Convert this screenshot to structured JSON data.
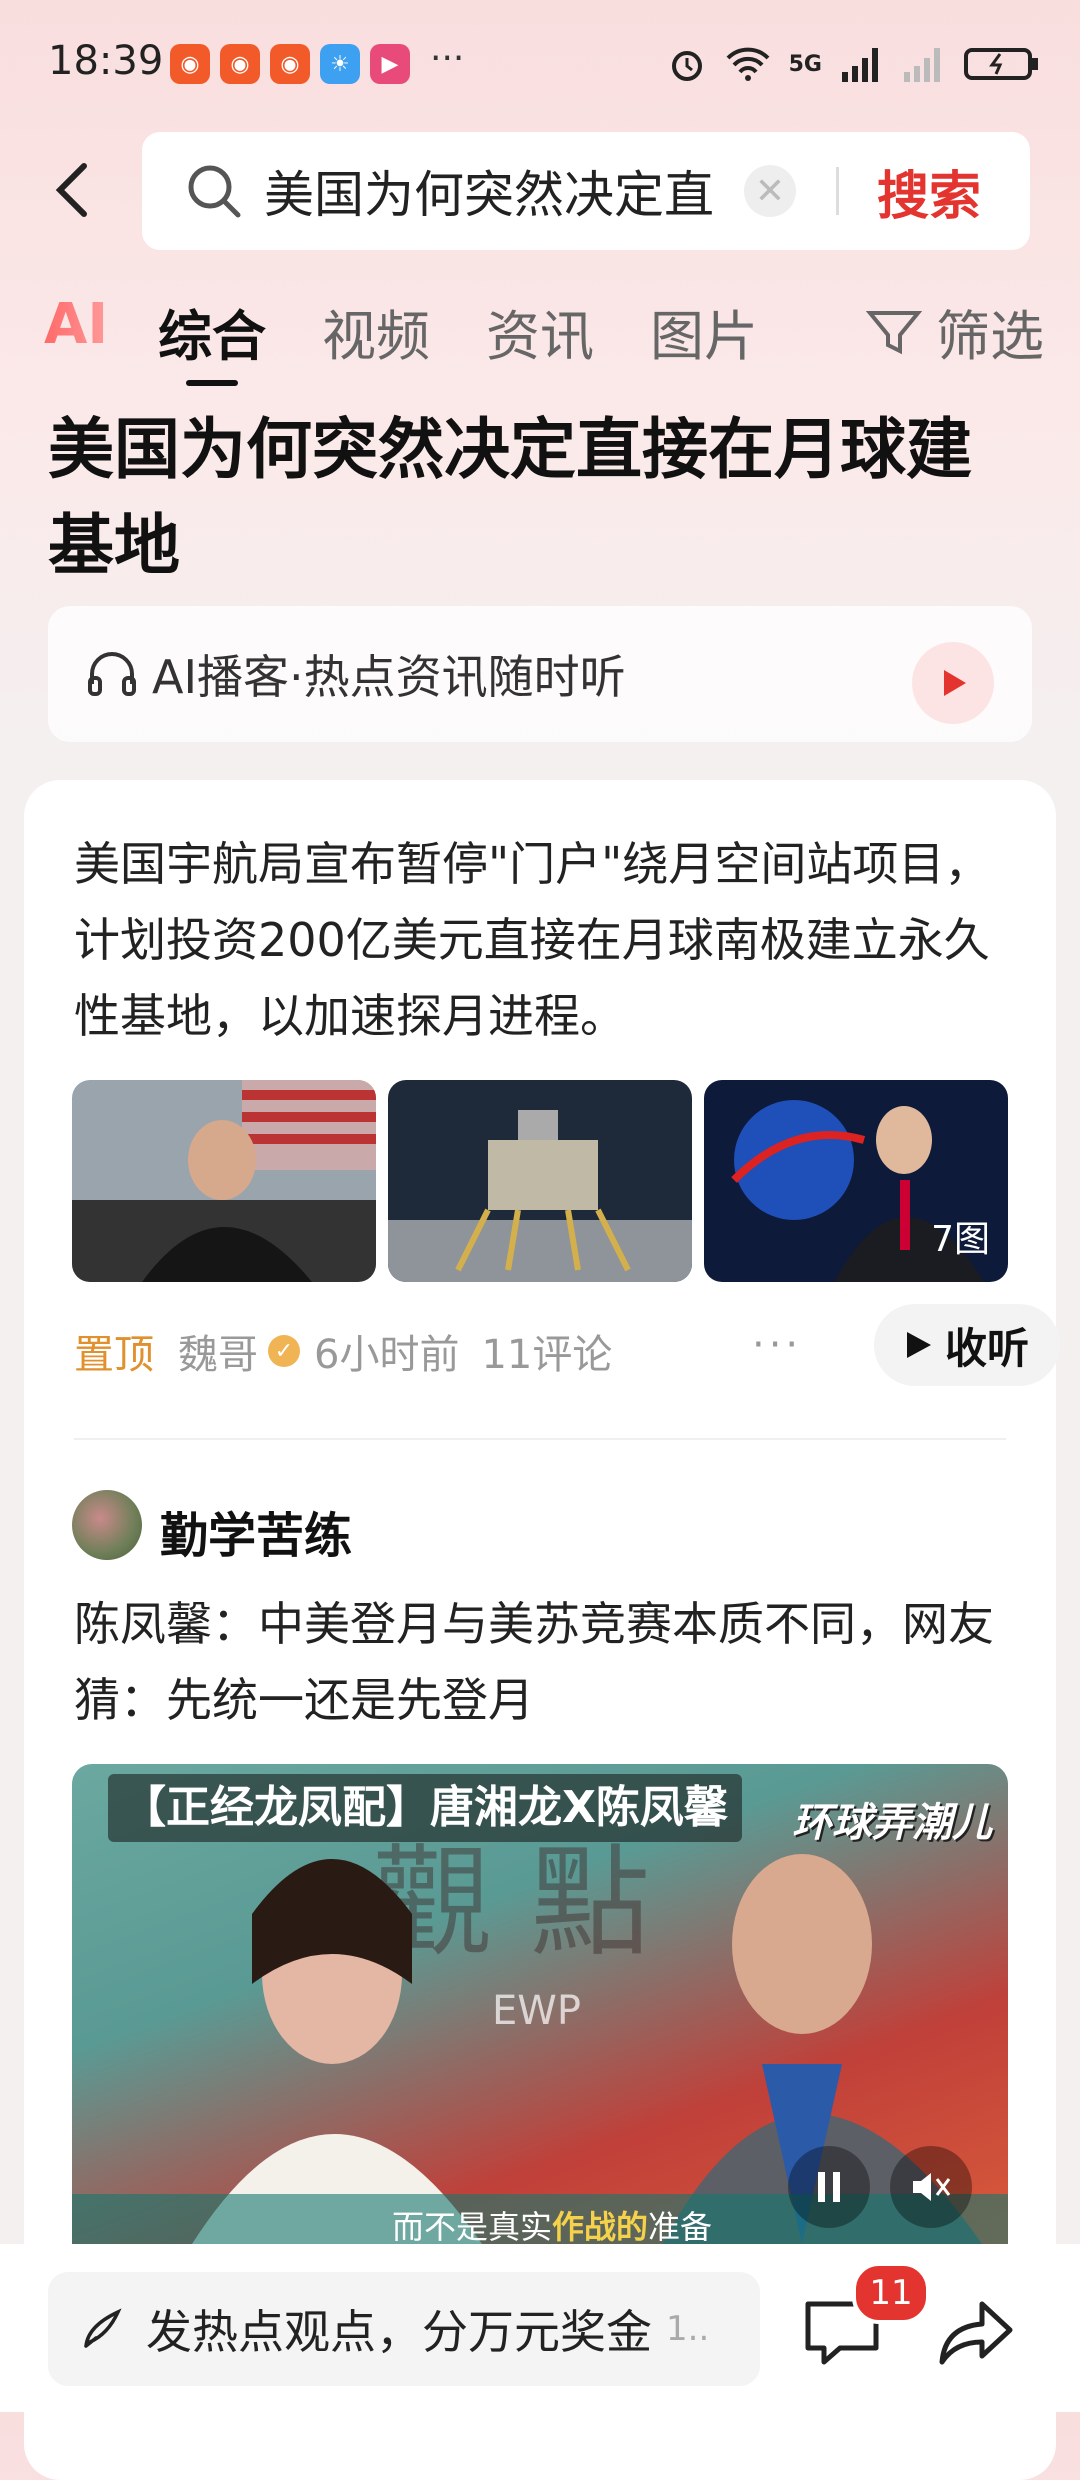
{
  "status_bar": {
    "time": "18:39",
    "more": "···",
    "network": "5G",
    "app_icons": [
      "app-icon-1",
      "app-icon-2",
      "app-icon-3",
      "weather-icon",
      "video-app-icon"
    ],
    "right_icons": [
      "alarm-icon",
      "wifi-icon",
      "signal-icon",
      "battery-icon"
    ]
  },
  "search": {
    "query": "美国为何突然决定直",
    "search_label": "搜索"
  },
  "tabs": {
    "ai": "AI",
    "items": [
      "综合",
      "视频",
      "资讯",
      "图片"
    ],
    "filter": "筛选"
  },
  "page_title": "美国为何突然决定直接在月球建基地",
  "podcast": {
    "label": "AI播客·热点资讯随时听"
  },
  "article": {
    "summary": "美国宇航局宣布暂停\"门户\"绕月空间站项目，计划投资200亿美元直接在月球南极建立永久性基地，以加速探月进程。",
    "image_count": "7图",
    "pin": "置顶",
    "author": "魏哥",
    "time": "6小时前",
    "comments": "11评论",
    "more": "···",
    "listen_label": "收听"
  },
  "post2": {
    "author": "勤学苦练",
    "headline": "陈凤馨：中美登月与美苏竞赛本质不同，网友猜：先统一还是先登月",
    "video_title": "【正经龙凤配】唐湘龙X陈凤馨",
    "video_brand": "环球弄潮儿",
    "subtitle_plain": "而不是真实",
    "subtitle_highlight": "作战的",
    "subtitle_end": "准备"
  },
  "bottom_bar": {
    "comment_placeholder": "发热点观点，分万元奖金",
    "comment_extra": "1..",
    "comment_badge": "11"
  },
  "colors": {
    "accent": "#e3342f",
    "pin": "#e0902d"
  }
}
